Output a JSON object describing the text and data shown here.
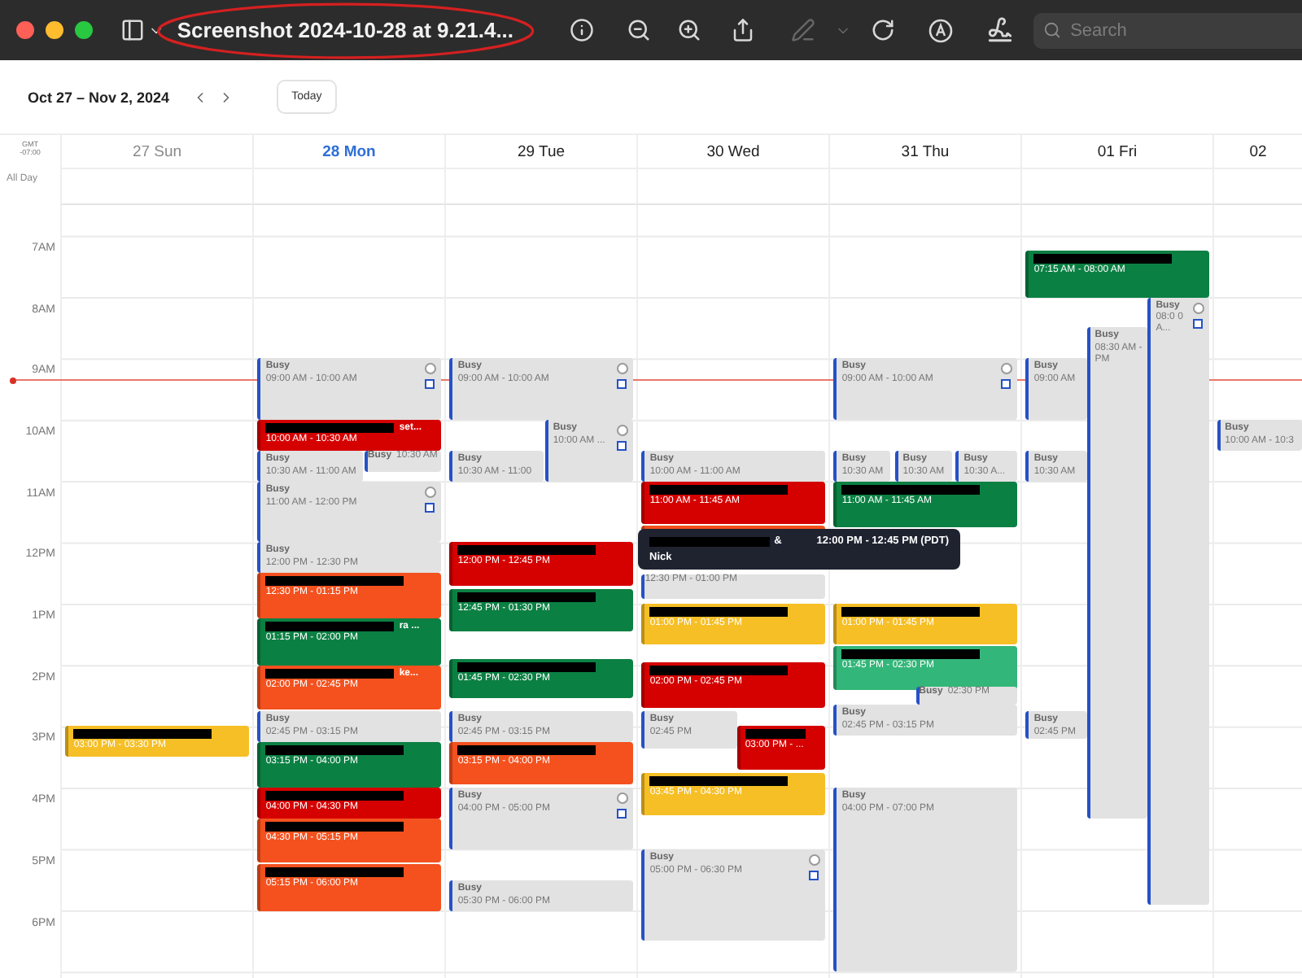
{
  "toolbar": {
    "title": "Screenshot 2024-10-28 at 9.21.4...",
    "search": {
      "placeholder": "Search"
    }
  },
  "calendar": {
    "range": "Oct 27 – Nov 2, 2024",
    "today_button": "Today",
    "timezone": [
      "GMT",
      "-07:00"
    ],
    "all_day": "All Day",
    "hours": [
      "7AM",
      "8AM",
      "9AM",
      "10AM",
      "11AM",
      "12PM",
      "1PM",
      "2PM",
      "3PM",
      "4PM",
      "5PM",
      "6PM"
    ],
    "days": [
      {
        "label": "27 Sun",
        "today": false,
        "past": true,
        "events": [
          {
            "kind": "meeting",
            "color": "#f6bf26",
            "time": "03:00 PM - 03:30 PM"
          }
        ]
      },
      {
        "label": "28 Mon",
        "today": true,
        "past": false,
        "events": [
          {
            "kind": "busy",
            "title": "Busy",
            "time": "09:00 AM - 10:00 AM",
            "actions": true
          },
          {
            "kind": "meeting",
            "color": "#d50000",
            "tail": "set...",
            "time": "10:00 AM - 10:30 AM"
          },
          {
            "kind": "busy",
            "title": "Busy",
            "time": "10:30 AM - 11:00 AM",
            "actions": false
          },
          {
            "kind": "busy-inline",
            "title": "Busy",
            "time": "10:30 AM"
          },
          {
            "kind": "busy",
            "title": "Busy",
            "time": "11:00 AM - 12:00 PM",
            "actions": true
          },
          {
            "kind": "busy",
            "title": "Busy",
            "time": "12:00 PM - 12:30 PM",
            "actions": false
          },
          {
            "kind": "meeting",
            "color": "#f4511e",
            "time": "12:30 PM - 01:15 PM"
          },
          {
            "kind": "meeting",
            "color": "#0b8043",
            "tail": "ra ...",
            "time": "01:15 PM - 02:00 PM"
          },
          {
            "kind": "meeting",
            "color": "#f4511e",
            "tail": "ke...",
            "time": "02:00 PM - 02:45 PM"
          },
          {
            "kind": "busy",
            "title": "Busy",
            "time": "02:45 PM - 03:15 PM",
            "actions": false
          },
          {
            "kind": "meeting",
            "color": "#0b8043",
            "time": "03:15 PM - 04:00 PM"
          },
          {
            "kind": "meeting",
            "color": "#d50000",
            "time": "04:00 PM - 04:30 PM"
          },
          {
            "kind": "meeting",
            "color": "#f4511e",
            "time": "04:30 PM - 05:15 PM"
          },
          {
            "kind": "meeting",
            "color": "#f4511e",
            "time": "05:15 PM - 06:00 PM"
          }
        ]
      },
      {
        "label": "29 Tue",
        "today": false,
        "past": false,
        "events": [
          {
            "kind": "busy",
            "title": "Busy",
            "time": "09:00 AM - 10:00 AM",
            "actions": true
          },
          {
            "kind": "busy",
            "title": "Busy",
            "time": "10:30 AM - 11:00",
            "actions": false
          },
          {
            "kind": "busy",
            "title": "Busy",
            "time": "10:00 AM ...",
            "actions": true
          },
          {
            "kind": "meeting",
            "color": "#d50000",
            "time": "12:00 PM - 12:45 PM"
          },
          {
            "kind": "meeting",
            "color": "#0b8043",
            "time": "12:45 PM - 01:30 PM"
          },
          {
            "kind": "meeting",
            "color": "#0b8043",
            "time": "01:45 PM - 02:30 PM"
          },
          {
            "kind": "busy",
            "title": "Busy",
            "time": "02:45 PM - 03:15 PM",
            "actions": false
          },
          {
            "kind": "meeting",
            "color": "#f4511e",
            "time": "03:15 PM - 04:00 PM"
          },
          {
            "kind": "busy",
            "title": "Busy",
            "time": "04:00 PM - 05:00 PM",
            "actions": true
          },
          {
            "kind": "busy",
            "title": "Busy",
            "time": "05:30 PM - 06:00 PM",
            "actions": false
          }
        ]
      },
      {
        "label": "30 Wed",
        "today": false,
        "past": false,
        "events": [
          {
            "kind": "busy",
            "title": "Busy",
            "time": "10:00 AM - 11:00 AM",
            "actions": false
          },
          {
            "kind": "meeting",
            "color": "#d50000",
            "time": "11:00 AM - 11:45 AM"
          },
          {
            "kind": "meeting",
            "color": "#f4511e"
          },
          {
            "kind": "busy-inline",
            "time": "12:30 PM - 01:00 PM"
          },
          {
            "kind": "meeting",
            "color": "#f6bf26",
            "time": "01:00 PM - 01:45 PM"
          },
          {
            "kind": "meeting",
            "color": "#d50000",
            "time": "02:00 PM - 02:45 PM"
          },
          {
            "kind": "busy",
            "title": "Busy",
            "time": "02:45 PM",
            "actions": false
          },
          {
            "kind": "meeting",
            "color": "#d50000",
            "time": "03:00 PM - ..."
          },
          {
            "kind": "meeting",
            "color": "#f6bf26",
            "time": "03:45 PM - 04:30 PM"
          },
          {
            "kind": "busy",
            "title": "Busy",
            "time": "05:00 PM - 06:30 PM",
            "actions": true
          }
        ]
      },
      {
        "label": "31 Thu",
        "today": false,
        "past": false,
        "events": [
          {
            "kind": "busy",
            "title": "Busy",
            "time": "09:00 AM - 10:00 AM",
            "actions": true
          },
          {
            "kind": "busy",
            "title": "Busy",
            "time": "10:30 AM",
            "actions": false
          },
          {
            "kind": "busy",
            "title": "Busy",
            "time": "10:30 AM",
            "actions": false
          },
          {
            "kind": "busy",
            "title": "Busy",
            "time": "10:30 A...",
            "actions": false
          },
          {
            "kind": "meeting",
            "color": "#0b8043",
            "time": "11:00 AM - 11:45 AM"
          },
          {
            "kind": "meeting",
            "color": "#f6bf26",
            "time": "01:00 PM - 01:45 PM"
          },
          {
            "kind": "meeting",
            "color": "#33b679",
            "time": "01:45 PM - 02:30 PM"
          },
          {
            "kind": "busy-inline",
            "title": "Busy",
            "time": "02:30 PM"
          },
          {
            "kind": "busy",
            "title": "Busy",
            "time": "02:45 PM - 03:15 PM",
            "actions": false
          },
          {
            "kind": "busy",
            "title": "Busy",
            "time": "04:00 PM - 07:00 PM",
            "actions": false
          }
        ]
      },
      {
        "label": "01 Fri",
        "today": false,
        "past": false,
        "events": [
          {
            "kind": "meeting",
            "color": "#0b8043",
            "time": "07:15 AM - 08:00 AM"
          },
          {
            "kind": "busy",
            "title": "Busy",
            "time": "09:00 AM",
            "actions": false
          },
          {
            "kind": "busy",
            "title": "Busy",
            "time": "10:30 AM",
            "actions": false
          },
          {
            "kind": "busy",
            "title": "Busy",
            "time": "02:45 PM",
            "actions": false
          },
          {
            "kind": "busy",
            "title": "Busy",
            "time": "08:30 AM - PM",
            "actions": false
          },
          {
            "kind": "busy",
            "title": "Busy",
            "time": "08:0 0 A...",
            "actions": true
          }
        ]
      },
      {
        "label": "02",
        "today": false,
        "past": false,
        "events": [
          {
            "kind": "busy",
            "title": "Busy",
            "time": "10:00 AM - 10:3",
            "actions": false
          }
        ]
      }
    ]
  },
  "tooltip": {
    "connector": "&",
    "time": "12:00 PM - 12:45 PM (PDT)",
    "name": "Nick"
  }
}
